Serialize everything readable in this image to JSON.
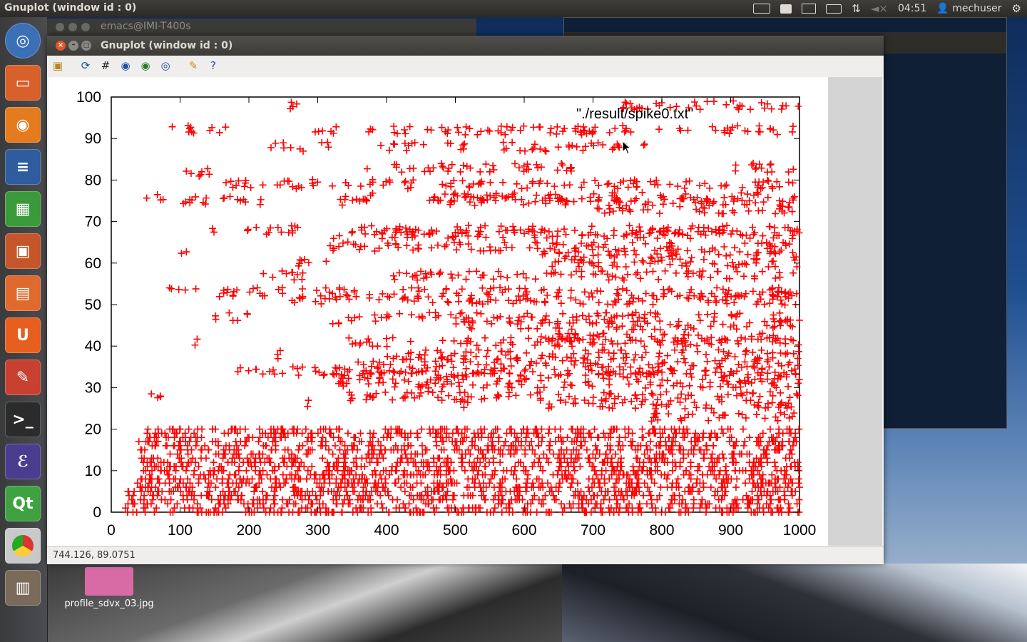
{
  "top_panel": {
    "app_title": "Gnuplot (window id : 0)",
    "time": "04:51",
    "user": "mechuser",
    "icons": [
      "keyboard-icon",
      "printer-icon",
      "mail-icon",
      "battery-icon",
      "network-icon",
      "volume-muted-icon",
      "user-icon",
      "gear-icon"
    ]
  },
  "launcher": {
    "items": [
      "ubuntu-dash",
      "files",
      "firefox",
      "writer",
      "calc",
      "impress",
      "software-center",
      "ubuntu-one",
      "system-settings",
      "terminal",
      "emacs",
      "qt-creator",
      "chrome",
      "trash"
    ]
  },
  "back_windows": {
    "emacs_title": "emacs@IMI-T400s"
  },
  "desktop": {
    "file_label": "profile_sdvx_03.jpg"
  },
  "gnuplot": {
    "window_title": "Gnuplot (window id : 0)",
    "toolbar": [
      "copy-icon",
      "replot-icon",
      "grid-icon",
      "zoom-prev-icon",
      "zoom-next-icon",
      "autoscale-icon",
      "config-icon",
      "help-icon"
    ],
    "status": "744.126, 89.0751"
  },
  "chart_data": {
    "type": "scatter",
    "series": [
      {
        "name": "\"./result/spike0.txt\"",
        "color": "#ff0000",
        "marker": "plus"
      }
    ],
    "xlim": [
      0,
      1000
    ],
    "ylim": [
      0,
      100
    ],
    "xticks": [
      "0",
      "100",
      "200",
      "300",
      "400",
      "500",
      "600",
      "700",
      "800",
      "900",
      "1000"
    ],
    "yticks": [
      "0",
      "10",
      "20",
      "30",
      "40",
      "50",
      "60",
      "70",
      "80",
      "90",
      "100"
    ],
    "legend": "top-right",
    "grid": false,
    "bands": [
      {
        "y": 92,
        "x": [
          [
            80,
            130
          ],
          [
            140,
            170
          ],
          [
            290,
            330
          ],
          [
            370,
            840
          ],
          [
            860,
            1000
          ]
        ]
      },
      {
        "y": 88,
        "x": [
          [
            230,
            280
          ],
          [
            300,
            320
          ],
          [
            390,
            460
          ],
          [
            480,
            520
          ],
          [
            560,
            780
          ]
        ]
      },
      {
        "y": 98,
        "x": [
          [
            240,
            270
          ],
          [
            740,
            1000
          ]
        ]
      },
      {
        "y": 83,
        "x": [
          [
            370,
            680
          ],
          [
            900,
            1000
          ]
        ]
      },
      {
        "y": 82,
        "x": [
          [
            100,
            150
          ]
        ]
      },
      {
        "y": 79,
        "x": [
          [
            150,
            310
          ],
          [
            320,
            440
          ],
          [
            480,
            1000
          ]
        ]
      },
      {
        "y": 76,
        "x": [
          [
            50,
            80
          ],
          [
            350,
            390
          ],
          [
            470,
            860
          ],
          [
            880,
            940
          ]
        ]
      },
      {
        "y": 75,
        "x": [
          [
            80,
            140
          ],
          [
            160,
            220
          ],
          [
            330,
            380
          ],
          [
            460,
            760
          ],
          [
            760,
            1000
          ]
        ]
      },
      {
        "y": 73,
        "x": [
          [
            700,
            1000
          ]
        ]
      },
      {
        "y": 68,
        "x": [
          [
            140,
            150
          ],
          [
            180,
            280
          ],
          [
            340,
            1000
          ]
        ]
      },
      {
        "y": 67,
        "x": [
          [
            320,
            1000
          ]
        ]
      },
      {
        "y": 64,
        "x": [
          [
            310,
            1000
          ]
        ]
      },
      {
        "y": 62,
        "x": [
          [
            100,
            110
          ],
          [
            620,
            1000
          ]
        ]
      },
      {
        "y": 60,
        "x": [
          [
            270,
            320
          ],
          [
            640,
            1000
          ]
        ]
      },
      {
        "y": 57,
        "x": [
          [
            210,
            280
          ],
          [
            410,
            1000
          ]
        ]
      },
      {
        "y": 54,
        "x": [
          [
            80,
            100
          ]
        ]
      },
      {
        "y": 53,
        "x": [
          [
            100,
            1000
          ]
        ]
      },
      {
        "y": 51,
        "x": [
          [
            250,
            1000
          ]
        ]
      },
      {
        "y": 47,
        "x": [
          [
            150,
            200
          ],
          [
            340,
            1000
          ]
        ]
      },
      {
        "y": 45,
        "x": [
          [
            320,
            340
          ],
          [
            500,
            1000
          ]
        ]
      },
      {
        "y": 42,
        "x": [
          [
            600,
            1000
          ]
        ]
      },
      {
        "y": 41,
        "x": [
          [
            120,
            130
          ],
          [
            340,
            440
          ],
          [
            480,
            1000
          ]
        ]
      },
      {
        "y": 38,
        "x": [
          [
            240,
            260
          ],
          [
            400,
            1000
          ]
        ]
      },
      {
        "y": 36,
        "x": [
          [
            350,
            1000
          ]
        ]
      },
      {
        "y": 34,
        "x": [
          [
            180,
            280
          ],
          [
            290,
            1000
          ]
        ]
      },
      {
        "y": 33,
        "x": [
          [
            320,
            1000
          ]
        ]
      },
      {
        "y": 31,
        "x": [
          [
            330,
            1000
          ]
        ]
      },
      {
        "y": 28,
        "x": [
          [
            50,
            80
          ],
          [
            330,
            860
          ],
          [
            880,
            1000
          ]
        ]
      },
      {
        "y": 26,
        "x": [
          [
            280,
            290
          ],
          [
            500,
            530
          ],
          [
            620,
            800
          ],
          [
            800,
            1000
          ]
        ]
      },
      {
        "y": 23,
        "x": [
          [
            780,
            1000
          ]
        ]
      },
      {
        "y": 10,
        "x": [
          [
            20,
            1000
          ]
        ]
      }
    ]
  }
}
